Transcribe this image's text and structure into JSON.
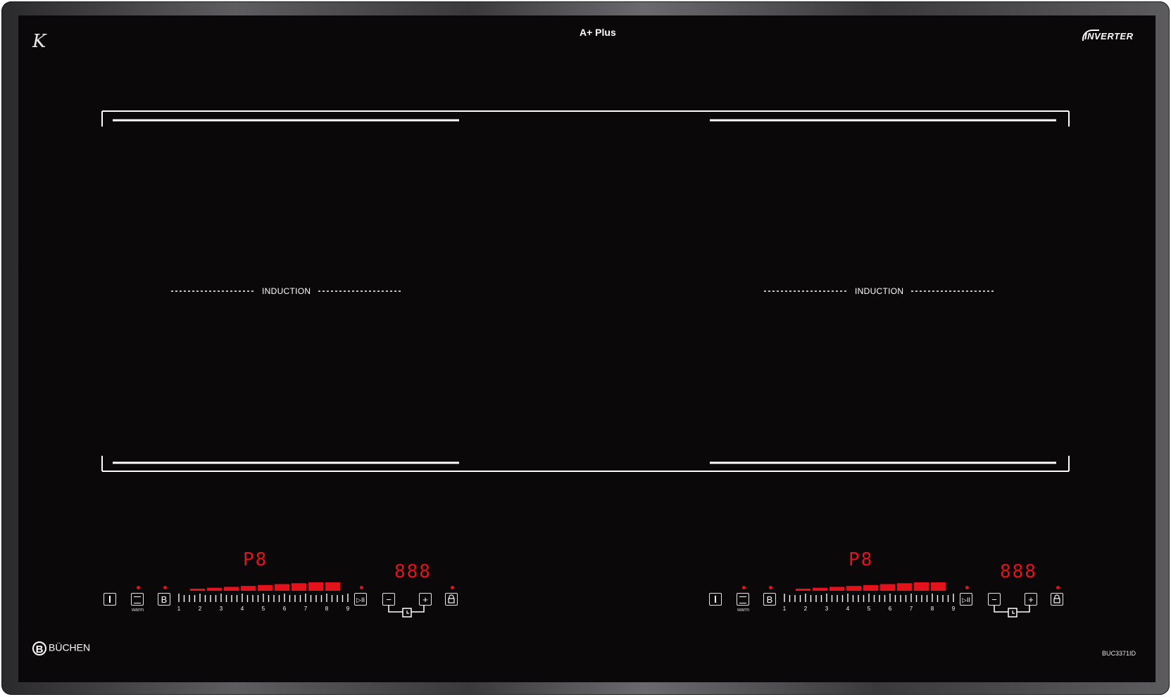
{
  "hob": {
    "top_left_logo": "K",
    "rating": "A+ Plus",
    "inverter": "INVERTER",
    "brand": "BÜCHEN",
    "brand_logo": "B",
    "model": "BUC3371ID"
  },
  "zones": [
    {
      "label": "INDUCTION"
    },
    {
      "label": "INDUCTION"
    }
  ],
  "controls": [
    {
      "power_display": "P8",
      "timer_display": "888",
      "power_icon": "power-icon",
      "warm_label": "warm",
      "boost_label": "B",
      "pause_icon": "play-pause-icon",
      "minus_label": "−",
      "plus_label": "+",
      "lock_icon": "lock-icon",
      "slider_numbers": [
        "1",
        "2",
        "3",
        "4",
        "5",
        "6",
        "7",
        "8",
        "9"
      ],
      "active_level": 9
    },
    {
      "power_display": "P8",
      "timer_display": "888",
      "power_icon": "power-icon",
      "warm_label": "warm",
      "boost_label": "B",
      "pause_icon": "play-pause-icon",
      "minus_label": "−",
      "plus_label": "+",
      "lock_icon": "lock-icon",
      "slider_numbers": [
        "1",
        "2",
        "3",
        "4",
        "5",
        "6",
        "7",
        "8",
        "9"
      ],
      "active_level": 9
    }
  ],
  "colors": {
    "glass": "#0b0809",
    "led_red": "#e3131b",
    "print": "#ffffff"
  }
}
